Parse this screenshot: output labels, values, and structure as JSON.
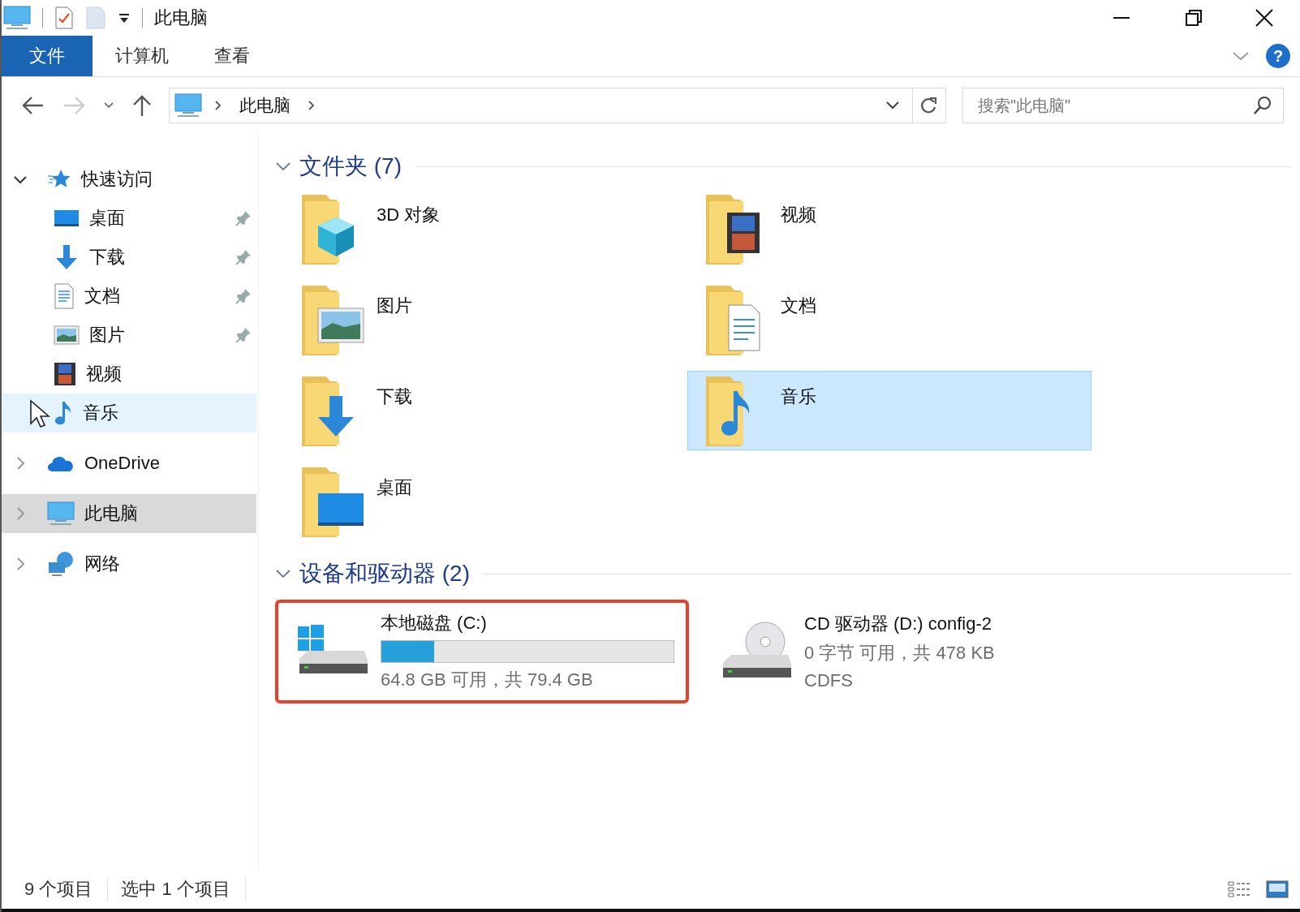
{
  "window": {
    "title": "此电脑"
  },
  "ribbon": {
    "tabs": [
      {
        "label": "文件",
        "selected": true
      },
      {
        "label": "计算机",
        "selected": false
      },
      {
        "label": "查看",
        "selected": false
      }
    ],
    "help": "?"
  },
  "address_bar": {
    "path": [
      "此电脑"
    ]
  },
  "search": {
    "placeholder": "搜索\"此电脑\""
  },
  "sidebar": {
    "items": [
      {
        "label": "快速访问",
        "kind": "star",
        "expanded": true,
        "selected": false,
        "hovered": false,
        "children": [
          {
            "label": "桌面",
            "kind": "desktop",
            "pinned": true,
            "selected": false,
            "hovered": false
          },
          {
            "label": "下载",
            "kind": "download",
            "pinned": true,
            "selected": false,
            "hovered": false
          },
          {
            "label": "文档",
            "kind": "document",
            "pinned": true,
            "selected": false,
            "hovered": false
          },
          {
            "label": "图片",
            "kind": "picture",
            "pinned": true,
            "selected": false,
            "hovered": false
          },
          {
            "label": "视频",
            "kind": "video",
            "pinned": false,
            "selected": false,
            "hovered": false
          },
          {
            "label": "音乐",
            "kind": "music",
            "pinned": false,
            "selected": false,
            "hovered": true
          }
        ]
      },
      {
        "label": "OneDrive",
        "kind": "cloud",
        "expanded": false,
        "selected": false,
        "hovered": false
      },
      {
        "label": "此电脑",
        "kind": "pc",
        "expanded": false,
        "selected": true,
        "hovered": false
      },
      {
        "label": "网络",
        "kind": "network",
        "expanded": false,
        "selected": false,
        "hovered": false
      }
    ]
  },
  "folders": {
    "title": "文件夹 (7)",
    "expanded": true,
    "items": [
      {
        "label": "3D 对象",
        "kind": "cube",
        "selected": false
      },
      {
        "label": "视频",
        "kind": "video",
        "selected": false
      },
      {
        "label": "图片",
        "kind": "picture",
        "selected": false
      },
      {
        "label": "文档",
        "kind": "document",
        "selected": false
      },
      {
        "label": "下载",
        "kind": "download",
        "selected": false
      },
      {
        "label": "音乐",
        "kind": "music",
        "selected": true
      },
      {
        "label": "桌面",
        "kind": "desktop",
        "selected": false
      }
    ]
  },
  "drives": {
    "title": "设备和驱动器 (2)",
    "expanded": true,
    "items": [
      {
        "label": "本地磁盘 (C:)",
        "kind": "disk",
        "level": 0.18,
        "lines": [
          "64.8 GB 可用，共 79.4 GB"
        ],
        "highlighted": true
      },
      {
        "label": "CD 驱动器 (D:) config-2",
        "kind": "cd",
        "lines": [
          "0 字节 可用，共 478 KB",
          "CDFS"
        ],
        "highlighted": false
      }
    ]
  },
  "status_bar": {
    "items": [
      "9 个项目",
      "选中 1 个项目"
    ]
  }
}
